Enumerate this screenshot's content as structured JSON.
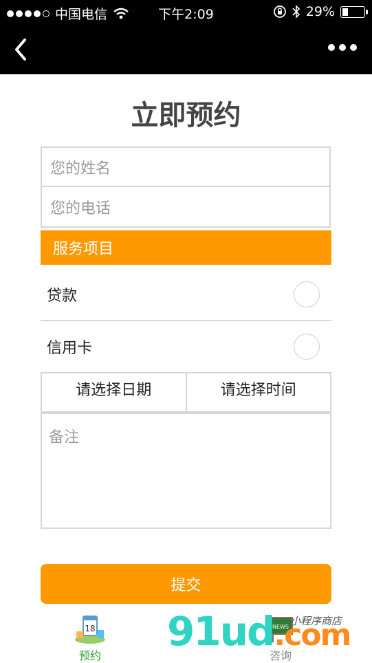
{
  "status_bar": {
    "carrier": "中国电信",
    "time": "下午2:09",
    "battery": "29%",
    "battery_level": 0.29
  },
  "nav": {
    "back_icon": "chevron-left-icon",
    "more_icon": "more-dots-icon"
  },
  "page": {
    "title": "立即预约"
  },
  "form": {
    "name_placeholder": "您的姓名",
    "phone_placeholder": "您的电话",
    "service_header": "服务项目",
    "options": [
      {
        "label": "贷款",
        "selected": false
      },
      {
        "label": "信用卡",
        "selected": false
      }
    ],
    "date_label": "请选择日期",
    "time_label": "请选择时间",
    "remark_placeholder": "备注",
    "submit_label": "提交"
  },
  "tabs": [
    {
      "label": "预约",
      "icon": "calendar-icon",
      "active": true
    },
    {
      "label": "咨询",
      "icon": "news-board-icon",
      "active": false
    }
  ],
  "watermark": {
    "brand_main": "91ud",
    "brand_suffix": ".com",
    "tagline": "小程序商店"
  },
  "colors": {
    "accent": "#ff9900",
    "active_tab": "#2d9d2d",
    "border": "#d6d6d6"
  }
}
